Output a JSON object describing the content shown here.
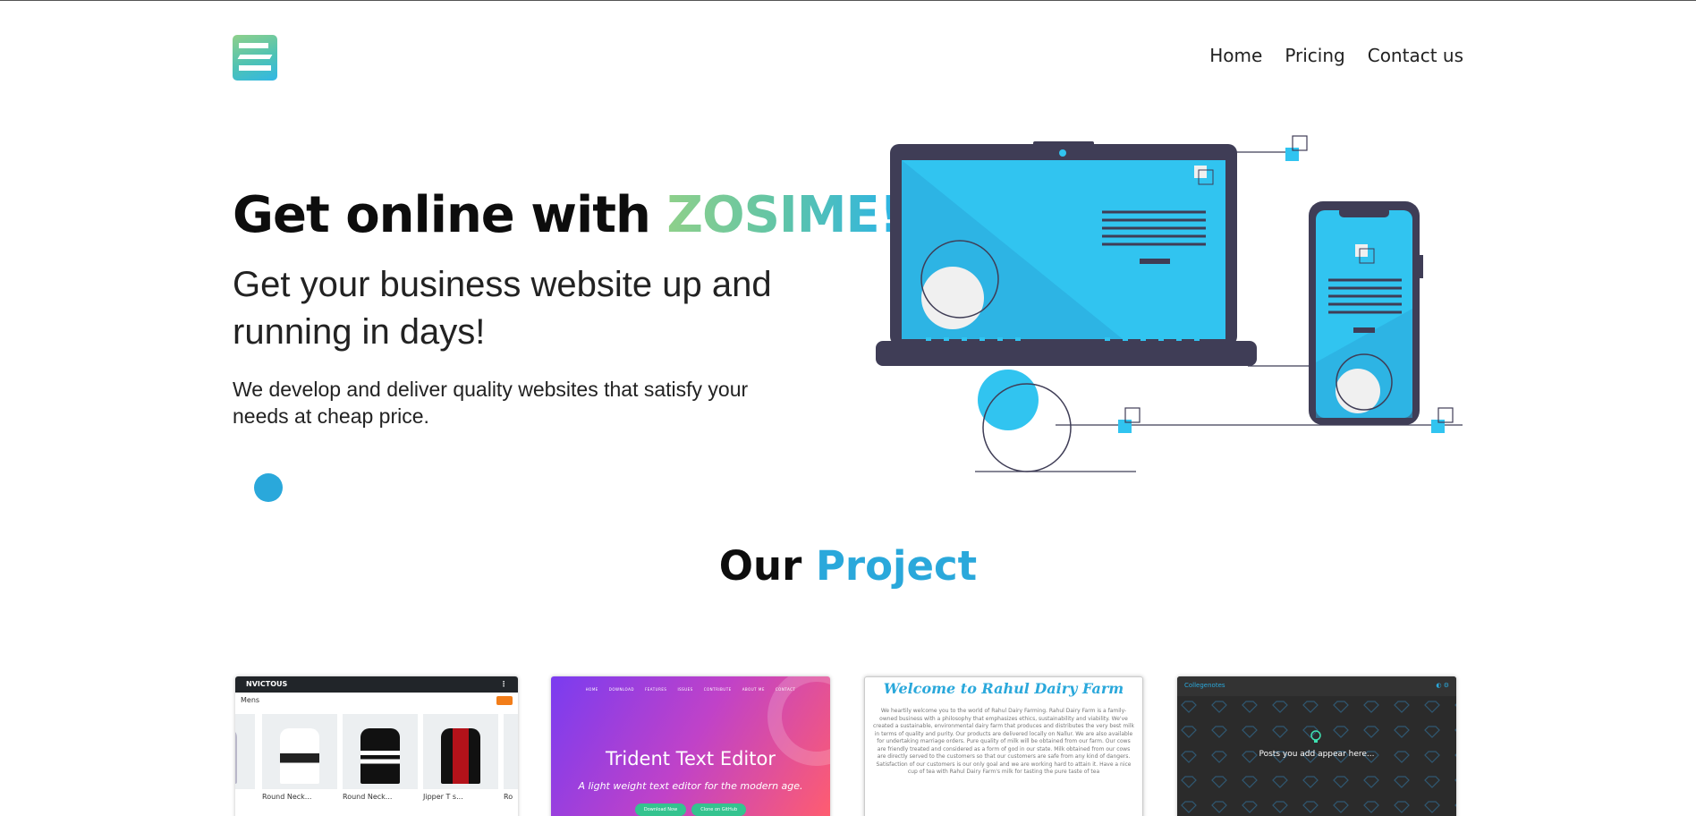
{
  "nav": {
    "items": [
      {
        "label": "Home"
      },
      {
        "label": "Pricing"
      },
      {
        "label": "Contact us"
      }
    ]
  },
  "hero": {
    "title_prefix": "Get online with ",
    "title_brand": "ZOSIME!",
    "subtitle": "Get your business website up and running in days!",
    "description": "We develop and deliver quality websites that satisfy your needs at cheap price."
  },
  "projects": {
    "title_prefix": "Our ",
    "title_accent": "Project",
    "cards": [
      {
        "brand": "NVICTOUS",
        "category": "Mens",
        "products": [
          "Round Neck...",
          "Round Neck...",
          "Jipper T s...",
          "Ro"
        ]
      },
      {
        "nav": [
          "HOME",
          "DOWNLOAD",
          "FEATURES",
          "ISSUES",
          "CONTRIBUTE",
          "ABOUT ME",
          "CONTACT"
        ],
        "title": "Trident Text Editor",
        "subtitle": "A light weight text editor for the modern age.",
        "buttons": [
          "Download Now",
          "Clone on GitHub"
        ]
      },
      {
        "title": "Welcome to Rahul Dairy Farm",
        "paragraph": "We heartily welcome you to the world of Rahul Dairy Farming. Rahul Dairy Farm is a family-owned business with a philosophy that emphasizes ethics, sustainability and viability. We've created a sustainable, environmental dairy farm that produces and distributes the very best milk in terms of quality and purity. Our products are delivered locally on Nallur. We are also available for undertaking marriage orders. Pure quality of milk will be obtained from our farm. Our cows are friendly treated and considered as a form of god in our state. Milk obtained from our cows are directly served to the customers so that our customers are safe from any kind of dangers. Satisfaction of our customers is our only goal and we are working hard to attain it. Have a nice cup of tea with Rahul Dairy Farm's milk for tasting the pure taste of tea"
      },
      {
        "app_name": "Collegenotes",
        "message": "Posts you add appear here..."
      }
    ]
  },
  "colors": {
    "accent": "#2aa8db",
    "brand_gradient_start": "#8fd08a",
    "brand_gradient_end": "#2ab4e8",
    "illustration_screen": "#31c4f0",
    "illustration_frame": "#3f3d56"
  }
}
